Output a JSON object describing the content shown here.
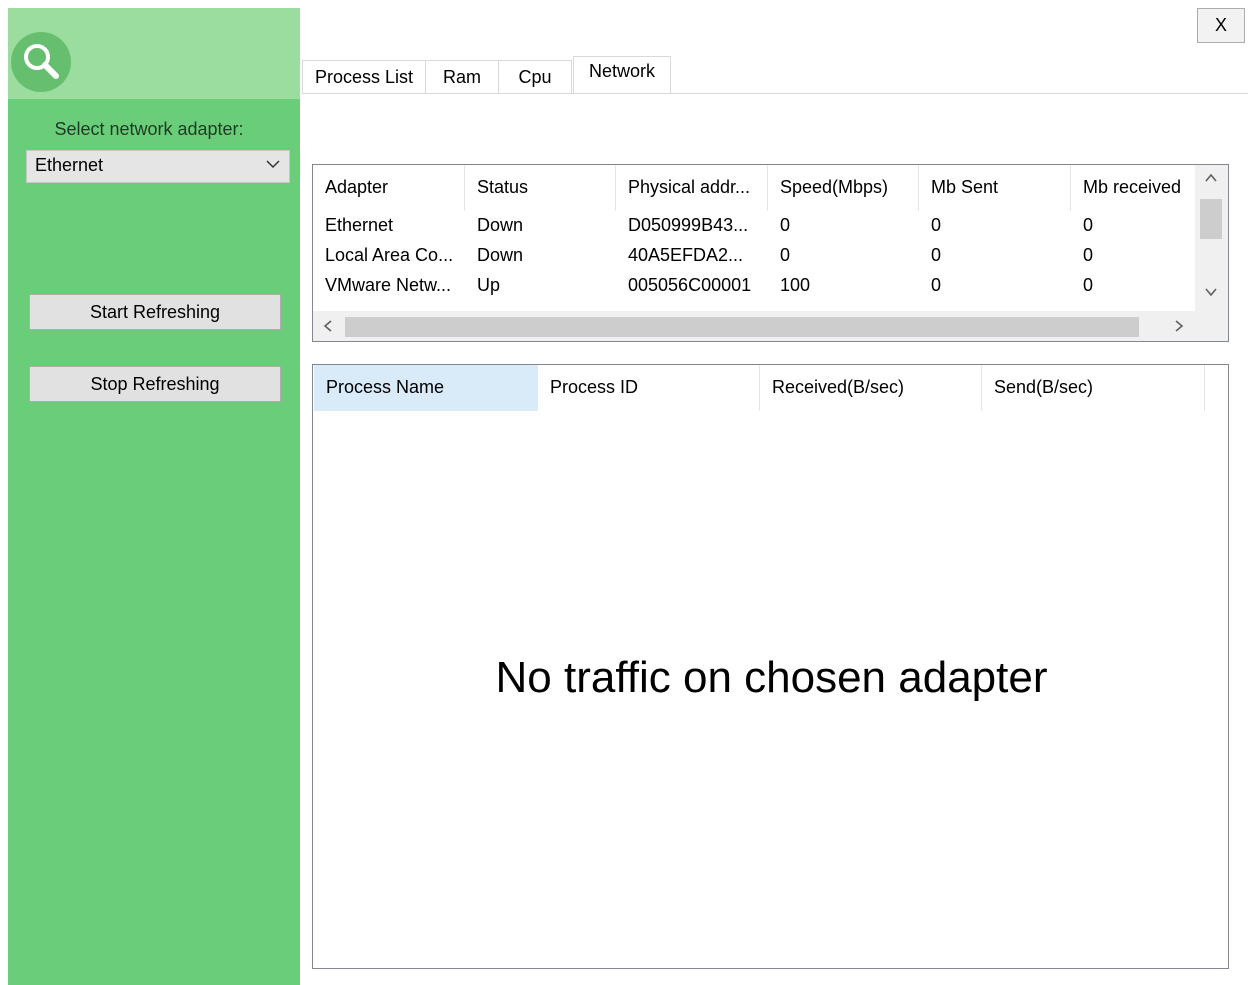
{
  "sidebar": {
    "adapter_label": "Select network adapter:",
    "selected_adapter": "Ethernet",
    "start_button": "Start Refreshing",
    "stop_button": "Stop Refreshing",
    "colors": {
      "panel": "#6acd7a",
      "header": "#9bdc9f"
    }
  },
  "window": {
    "close_label": "X"
  },
  "tabs": [
    {
      "label": "Process List",
      "active": false
    },
    {
      "label": "Ram",
      "active": false
    },
    {
      "label": "Cpu",
      "active": false
    },
    {
      "label": "Network",
      "active": true
    }
  ],
  "adapters": {
    "columns": [
      "Adapter",
      "Status",
      "Physical addr...",
      "Speed(Mbps)",
      "Mb Sent",
      "Mb received"
    ],
    "rows": [
      [
        "Ethernet",
        "Down",
        "D050999B43...",
        "0",
        "0",
        "0"
      ],
      [
        "Local Area Co...",
        "Down",
        "40A5EFDA2...",
        "0",
        "0",
        "0"
      ],
      [
        "VMware Netw...",
        "Up",
        "005056C00001",
        "100",
        "0",
        "0"
      ]
    ]
  },
  "processes": {
    "columns": [
      "Process Name",
      "Process ID",
      "Received(B/sec)",
      "Send(B/sec)"
    ],
    "empty_message": "No traffic on chosen adapter"
  }
}
